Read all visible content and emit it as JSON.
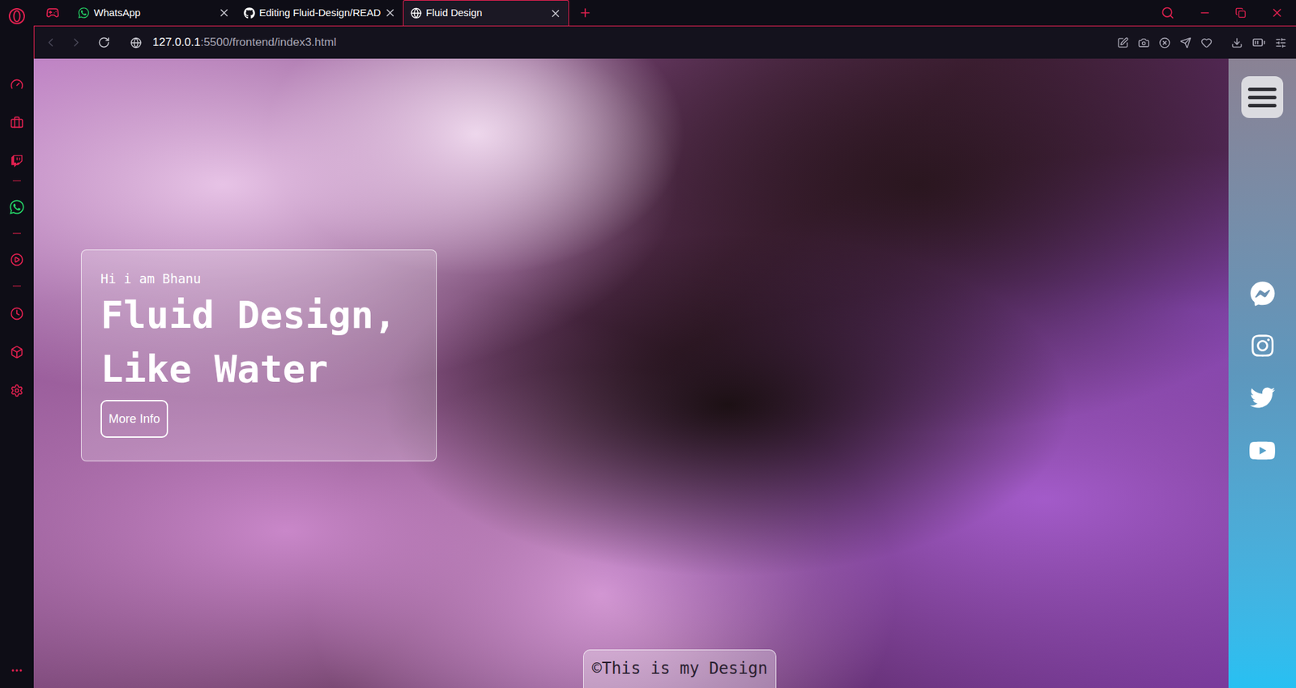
{
  "browser": {
    "tabs": [
      {
        "label": "WhatsApp",
        "selected": false
      },
      {
        "label": "Editing Fluid-Design/READ",
        "selected": false
      },
      {
        "label": "Fluid Design",
        "selected": true
      }
    ],
    "address": {
      "host": "127.0.0.1",
      "path": ":5500/frontend/index3.html"
    }
  },
  "page": {
    "hero": {
      "greeting": "Hi i am Bhanu",
      "heading": "Fluid Design, Like Water",
      "button": "More Info"
    },
    "footer": "©This is my Design"
  }
}
